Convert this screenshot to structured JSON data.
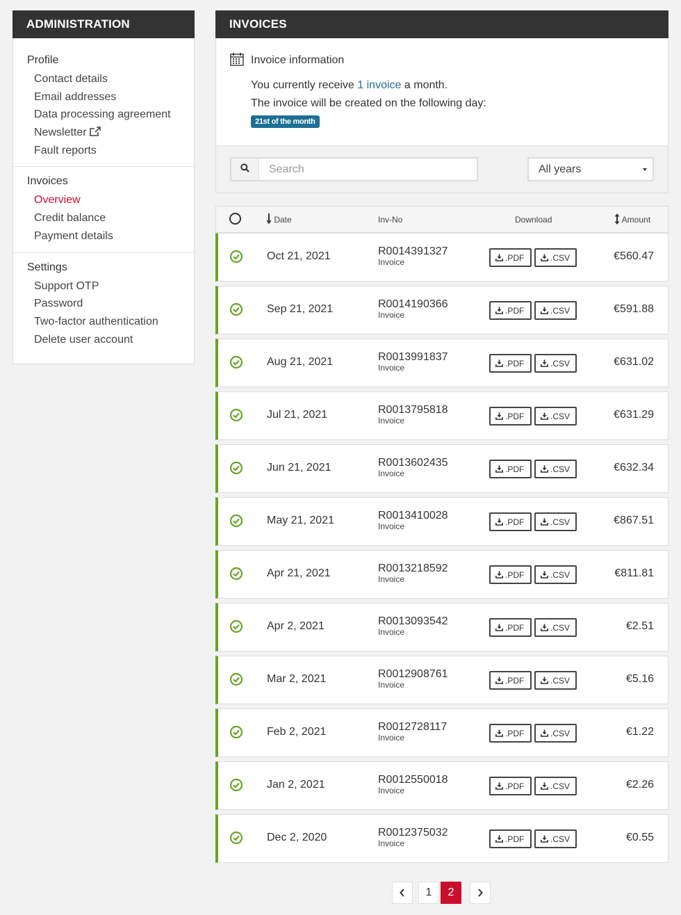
{
  "sidebar": {
    "title": "ADMINISTRATION",
    "groups": [
      {
        "title": "Profile",
        "items": [
          {
            "label": "Contact details"
          },
          {
            "label": "Email addresses"
          },
          {
            "label": "Data processing agreement"
          },
          {
            "label": "Newsletter",
            "icon": "external-link-icon"
          },
          {
            "label": "Fault reports"
          }
        ]
      },
      {
        "title": "Invoices",
        "items": [
          {
            "label": "Overview",
            "active": true
          },
          {
            "label": "Credit balance"
          },
          {
            "label": "Payment details"
          }
        ]
      },
      {
        "title": "Settings",
        "items": [
          {
            "label": "Support OTP"
          },
          {
            "label": "Password"
          },
          {
            "label": "Two-factor authentication"
          },
          {
            "label": "Delete user account"
          }
        ]
      }
    ]
  },
  "main": {
    "title": "INVOICES",
    "info": {
      "title": "Invoice information",
      "line1_prefix": "You currently receive",
      "line1_link": "1 invoice",
      "line1_suffix": "a month.",
      "line2": "The invoice will be created on the following day:",
      "badge": "21st of the month"
    },
    "search": {
      "placeholder": "Search"
    },
    "year_filter": {
      "selected": "All years"
    }
  },
  "table": {
    "headers": {
      "date": "Date",
      "invno": "Inv-No",
      "download": "Download",
      "amount": "Amount"
    },
    "pdf_label": ".PDF",
    "csv_label": ".CSV",
    "rows": [
      {
        "date": "Oct 21, 2021",
        "invno": "R0014391327",
        "type": "Invoice",
        "amount": "€560.47"
      },
      {
        "date": "Sep 21, 2021",
        "invno": "R0014190366",
        "type": "Invoice",
        "amount": "€591.88"
      },
      {
        "date": "Aug 21, 2021",
        "invno": "R0013991837",
        "type": "Invoice",
        "amount": "€631.02"
      },
      {
        "date": "Jul 21, 2021",
        "invno": "R0013795818",
        "type": "Invoice",
        "amount": "€631.29"
      },
      {
        "date": "Jun 21, 2021",
        "invno": "R0013602435",
        "type": "Invoice",
        "amount": "€632.34"
      },
      {
        "date": "May 21, 2021",
        "invno": "R0013410028",
        "type": "Invoice",
        "amount": "€867.51"
      },
      {
        "date": "Apr 21, 2021",
        "invno": "R0013218592",
        "type": "Invoice",
        "amount": "€811.81"
      },
      {
        "date": "Apr 2, 2021",
        "invno": "R0013093542",
        "type": "Invoice",
        "amount": "€2.51"
      },
      {
        "date": "Mar 2, 2021",
        "invno": "R0012908761",
        "type": "Invoice",
        "amount": "€5.16"
      },
      {
        "date": "Feb 2, 2021",
        "invno": "R0012728117",
        "type": "Invoice",
        "amount": "€1.22"
      },
      {
        "date": "Jan 2, 2021",
        "invno": "R0012550018",
        "type": "Invoice",
        "amount": "€2.26"
      },
      {
        "date": "Dec 2, 2020",
        "invno": "R0012375032",
        "type": "Invoice",
        "amount": "€0.55"
      }
    ]
  },
  "pagination": {
    "pages": [
      "1",
      "2"
    ],
    "current": "2"
  },
  "colors": {
    "accent_red": "#c8102e",
    "link_blue": "#1e6f94",
    "paid_green": "#6aa329",
    "header_dark": "#333333"
  }
}
